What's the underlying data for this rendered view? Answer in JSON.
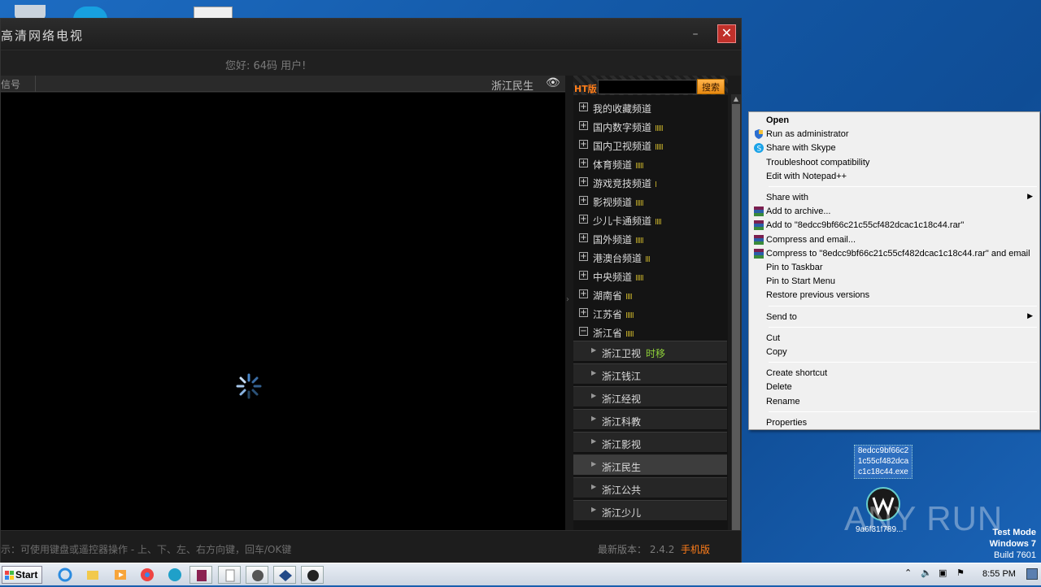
{
  "window": {
    "title": "高清网络电视",
    "minimize": "–",
    "close": "✕",
    "greeting": "您好: 64码 用户!"
  },
  "header": {
    "left_label": "信号",
    "current_channel": "浙江民生"
  },
  "search": {
    "tag": "HT版",
    "button": "搜索"
  },
  "categories": [
    {
      "label": "我的收藏频道",
      "bars": "",
      "toggle": "+"
    },
    {
      "label": "国内数字频道",
      "bars": "IIIII",
      "toggle": "+"
    },
    {
      "label": "国内卫视频道",
      "bars": "IIIII",
      "toggle": "+"
    },
    {
      "label": "体育频道",
      "bars": "IIIII",
      "toggle": "+"
    },
    {
      "label": "游戏竞技频道",
      "bars": "I",
      "toggle": "+"
    },
    {
      "label": "影视频道",
      "bars": "IIIII",
      "toggle": "+"
    },
    {
      "label": "少儿卡通频道",
      "bars": "IIII",
      "toggle": "+"
    },
    {
      "label": "国外频道",
      "bars": "IIIII",
      "toggle": "+"
    },
    {
      "label": "港澳台频道",
      "bars": "III",
      "toggle": "+"
    },
    {
      "label": "中央频道",
      "bars": "IIIII",
      "toggle": "+"
    },
    {
      "label": "湖南省",
      "bars": "IIII",
      "toggle": "+"
    },
    {
      "label": "江苏省",
      "bars": "IIIII",
      "toggle": "+"
    },
    {
      "label": "浙江省",
      "bars": "IIIII",
      "toggle": "−"
    }
  ],
  "channels": [
    {
      "label": "浙江卫视",
      "extra": "时移"
    },
    {
      "label": "浙江钱江",
      "extra": ""
    },
    {
      "label": "浙江经视",
      "extra": ""
    },
    {
      "label": "浙江科教",
      "extra": ""
    },
    {
      "label": "浙江影视",
      "extra": ""
    },
    {
      "label": "浙江民生",
      "extra": ""
    },
    {
      "label": "浙江公共",
      "extra": ""
    },
    {
      "label": "浙江少儿",
      "extra": ""
    }
  ],
  "selected_channel": "浙江民生",
  "status": {
    "tip": "示：可使用键盘或遥控器操作 - 上、下、左、右方向键，回车/OK键",
    "version_label": "最新版本：",
    "version": "2.4.2",
    "mobile": "手机版"
  },
  "context_menu": [
    {
      "label": "Open",
      "bold": true,
      "icon": ""
    },
    {
      "label": "Run as administrator",
      "icon": "shield-icon"
    },
    {
      "label": "Share with Skype",
      "icon": "skype-icon"
    },
    {
      "label": "Troubleshoot compatibility",
      "icon": ""
    },
    {
      "label": "Edit with Notepad++",
      "icon": ""
    },
    {
      "sep": true
    },
    {
      "label": "Share with",
      "icon": "",
      "submenu": true
    },
    {
      "label": "Add to archive...",
      "icon": "winrar-icon"
    },
    {
      "label": "Add to \"8edcc9bf66c21c55cf482dcac1c18c44.rar\"",
      "icon": "winrar-icon"
    },
    {
      "label": "Compress and email...",
      "icon": "winrar-icon"
    },
    {
      "label": "Compress to \"8edcc9bf66c21c55cf482dcac1c18c44.rar\" and email",
      "icon": "winrar-icon"
    },
    {
      "label": "Pin to Taskbar",
      "icon": ""
    },
    {
      "label": "Pin to Start Menu",
      "icon": ""
    },
    {
      "label": "Restore previous versions",
      "icon": ""
    },
    {
      "sep": true
    },
    {
      "label": "Send to",
      "icon": "",
      "submenu": true
    },
    {
      "sep": true
    },
    {
      "label": "Cut",
      "icon": ""
    },
    {
      "label": "Copy",
      "icon": ""
    },
    {
      "sep": true
    },
    {
      "label": "Create shortcut",
      "icon": ""
    },
    {
      "label": "Delete",
      "icon": ""
    },
    {
      "label": "Rename",
      "icon": ""
    },
    {
      "sep": true
    },
    {
      "label": "Properties",
      "icon": ""
    }
  ],
  "desktop": {
    "selected_file_lines": [
      "8edcc9bf66c2",
      "1c55cf482dca",
      "c1c18c44.exe"
    ],
    "icon2_label": "9a6f31f789...",
    "watermark": "ANY RUN",
    "test_mode": [
      "Test Mode",
      "Windows 7",
      "Build 7601"
    ]
  },
  "taskbar": {
    "start": "Start",
    "clock": "8:55 PM"
  }
}
